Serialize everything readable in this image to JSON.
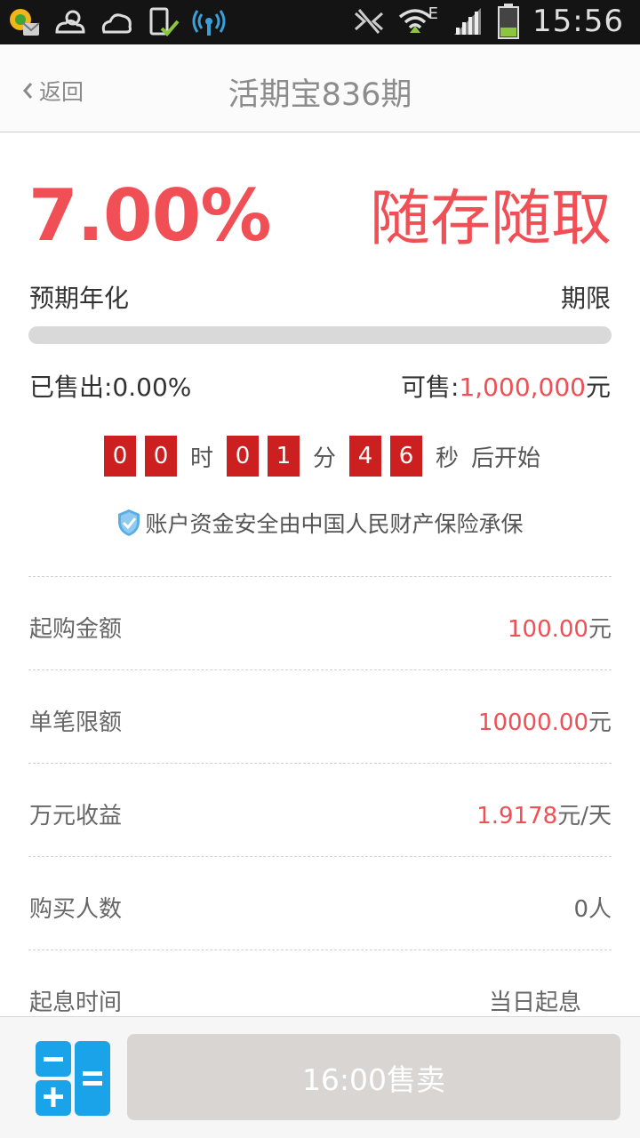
{
  "status_bar": {
    "time": "15:56",
    "network": "E",
    "icons": [
      "notification-icon",
      "weather-sunny-icon",
      "weather-cloud-icon",
      "sim-check-icon",
      "signal-broadcast-icon",
      "nfc-icon",
      "wifi-icon",
      "cell-signal-icon",
      "battery-icon"
    ]
  },
  "header": {
    "back_label": "返回",
    "title": "活期宝836期"
  },
  "product": {
    "rate": "7.00%",
    "rate_label": "预期年化",
    "term": "随存随取",
    "term_label": "期限",
    "sold_progress": 0.0,
    "sold_label": "已售出:0.00%",
    "available_prefix": "可售:",
    "available_amount": "1,000,000",
    "available_unit": "元"
  },
  "countdown": {
    "hours": [
      "0",
      "0"
    ],
    "hours_unit": "时",
    "minutes": [
      "0",
      "1"
    ],
    "minutes_unit": "分",
    "seconds": [
      "4",
      "6"
    ],
    "seconds_unit": "秒",
    "suffix": "后开始"
  },
  "security_note": "账户资金安全由中国人民财产保险承保",
  "details": [
    {
      "label": "起购金额",
      "value": "100.00",
      "unit": "元"
    },
    {
      "label": "单笔限额",
      "value": "10000.00",
      "unit": "元"
    },
    {
      "label": "万元收益",
      "value": "1.9178",
      "unit": "元/天"
    },
    {
      "label": "购买人数",
      "value": "0人",
      "unit": ""
    },
    {
      "label": "起息时间",
      "value": "当日起息",
      "unit": ""
    }
  ],
  "bottom": {
    "buy_button": "16:00售卖",
    "calculator_icon": "calculator-icon"
  },
  "colors": {
    "accent": "#ef4f55",
    "countdown_digit": "#cc1f1f",
    "calculator": "#1aa3e8",
    "button_disabled": "#d8d5d3"
  }
}
